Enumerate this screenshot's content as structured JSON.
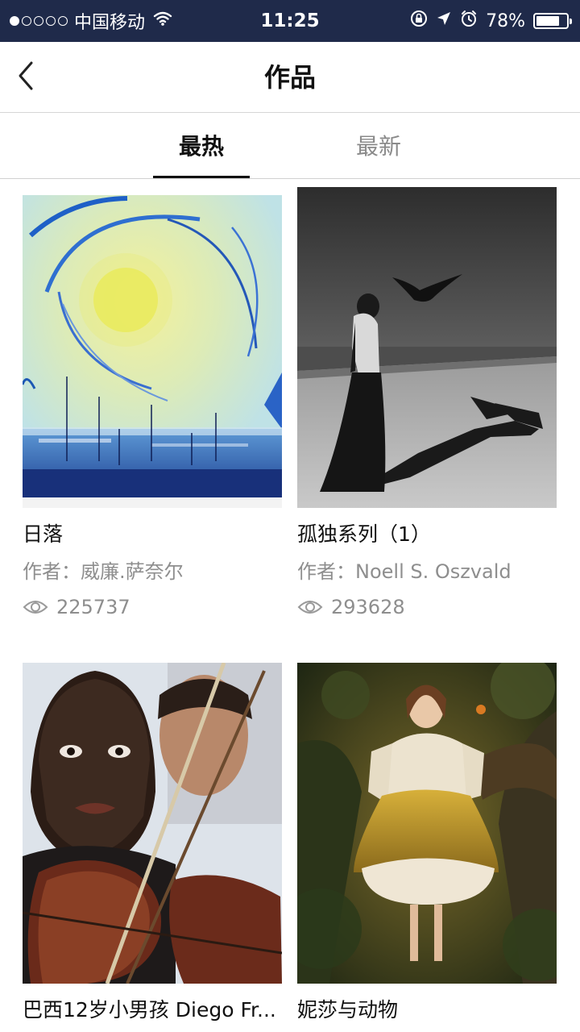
{
  "status_bar": {
    "carrier": "中国移动",
    "time": "11:25",
    "battery_percent": "78%",
    "battery_level": 0.78,
    "signal_bars_filled": 1,
    "signal_bars_total": 5
  },
  "nav": {
    "back_icon": "chevron-left-icon",
    "title": "作品"
  },
  "tabs": [
    {
      "label": "最热",
      "active": true
    },
    {
      "label": "最新",
      "active": false
    }
  ],
  "artworks": [
    {
      "title": "日落",
      "author": "作者：威廉.萨奈尔",
      "views": "225737"
    },
    {
      "title": "孤独系列（1）",
      "author": "作者：Noell S. Oszvald",
      "views": "293628"
    },
    {
      "title": "巴西12岁小男孩 Diego Fr...",
      "author": "",
      "views": ""
    },
    {
      "title": "妮莎与动物",
      "author": "",
      "views": ""
    }
  ],
  "colors": {
    "status_bar_bg": "#1f2a4a",
    "text_primary": "#111111",
    "text_secondary": "#8e8e8e"
  }
}
